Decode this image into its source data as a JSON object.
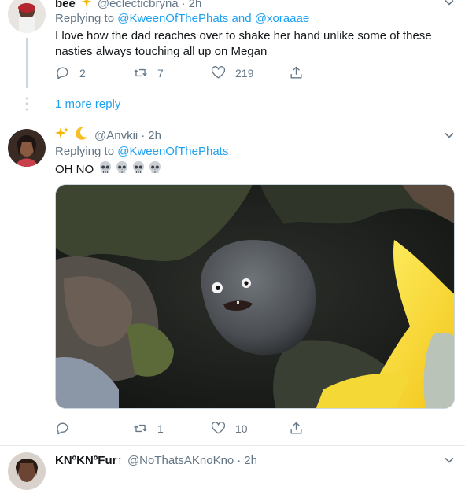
{
  "tweet1": {
    "name": "bee",
    "name_emoji": "sparkles",
    "handle": "@eclecticbryna",
    "time": "2h",
    "replying_prefix": "Replying to",
    "mention1": "@KweenOfThePhats",
    "and_word": "and",
    "mention2": "@xoraaae",
    "text": "I love how the dad reaches over to shake her hand unlike some of these nasties always touching all up on Megan",
    "replies": "2",
    "retweets": "7",
    "likes": "219",
    "more_replies": "1 more reply"
  },
  "tweet2": {
    "name_emojis": [
      "sparkles",
      "crescent-moon"
    ],
    "handle": "@Anvkii",
    "time": "2h",
    "replying_prefix": "Replying to",
    "mention1": "@KweenOfThePhats",
    "text": "OH NO",
    "text_emojis": [
      "skull",
      "skull",
      "skull",
      "skull"
    ],
    "replies": "",
    "retweets": "1",
    "likes": "10"
  },
  "tweet3": {
    "name": "KNºKNºFur↑",
    "handle": "@NoThatsAKnoKno",
    "time": "2h"
  },
  "separator": "·",
  "colors": {
    "link": "#1da1f2",
    "muted": "#657786",
    "text": "#14171a",
    "divider": "#e6ecf0"
  }
}
